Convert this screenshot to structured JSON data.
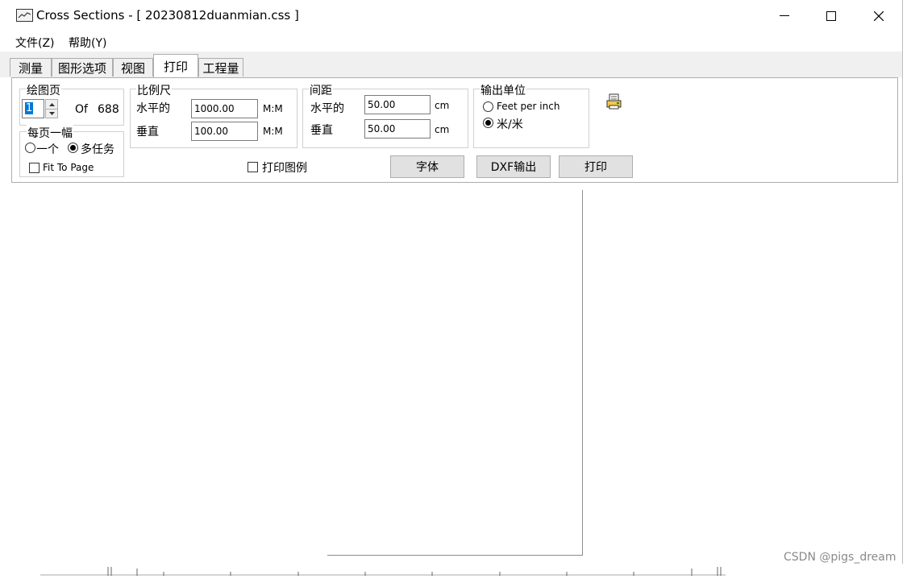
{
  "window": {
    "title": "Cross Sections - [ 20230812duanmian.css ]",
    "controls": {
      "minimize": "minimize",
      "maximize": "maximize",
      "close": "close"
    }
  },
  "menu": [
    "文件(Z)",
    "帮助(Y)"
  ],
  "tabs": [
    "测量",
    "图形选项",
    "视图",
    "打印",
    "工程量"
  ],
  "active_tab": "打印",
  "print": {
    "page_group": {
      "title": "绘图页",
      "current_page": "1",
      "of_label": "Of",
      "total_pages": "688"
    },
    "per_page_group": {
      "title": "每页一幅",
      "single_label": "一个",
      "multi_label": "多任务",
      "selected": "multi",
      "fit_to_page_label": "Fit To Page",
      "fit_to_page_checked": false
    },
    "scale_group": {
      "title": "比例尺",
      "horizontal_label": "水平的",
      "horizontal_value": "1000.00",
      "horizontal_unit": "M:M",
      "vertical_label": "垂直",
      "vertical_value": "100.00",
      "vertical_unit": "M:M"
    },
    "spacing_group": {
      "title": "间距",
      "horizontal_label": "水平的",
      "horizontal_value": "50.00",
      "horizontal_unit": "cm",
      "vertical_label": "垂直",
      "vertical_value": "50.00",
      "vertical_unit": "cm"
    },
    "output_unit_group": {
      "title": "输出单位",
      "feet_label": "Feet per inch",
      "meter_label": "米/米",
      "selected": "meter"
    },
    "print_legend_label": "打印图例",
    "print_legend_checked": false,
    "buttons": {
      "font": "字体",
      "dxf": "DXF输出",
      "print": "打印"
    }
  },
  "watermark": "CSDN @pigs_dream"
}
